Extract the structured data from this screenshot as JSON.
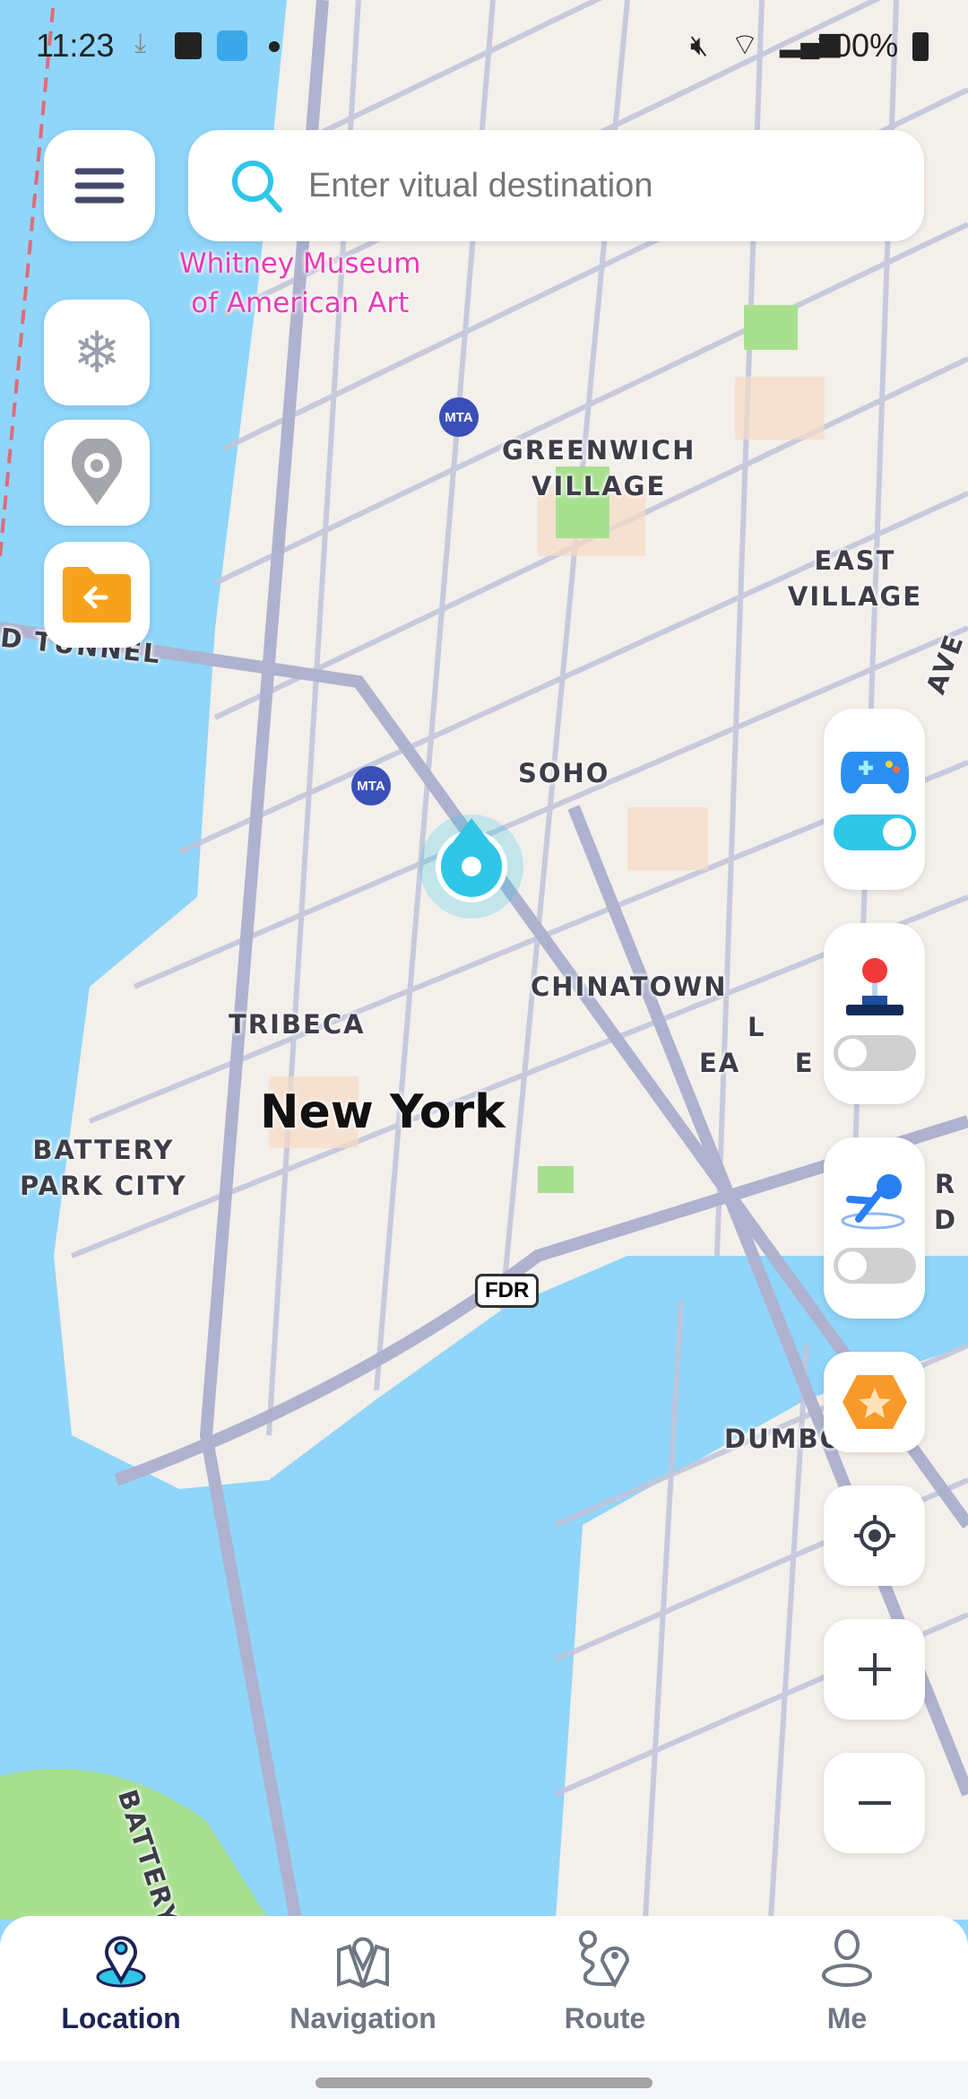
{
  "status_bar": {
    "time": "11:23",
    "battery": "100%"
  },
  "search": {
    "placeholder": "Enter vitual destination"
  },
  "map": {
    "labels": [
      {
        "text": "GREENWICH\nVILLAGE"
      },
      {
        "text": "EAST VILLAGE"
      },
      {
        "text": "SOHO"
      },
      {
        "text": "CHINATOWN"
      },
      {
        "text": "TRIBECA"
      },
      {
        "text": "L\nEA     E"
      },
      {
        "text": "BATTERY\nPARK CITY"
      },
      {
        "text": "DUMBO"
      },
      {
        "text": "D TUNNEL"
      },
      {
        "text": "AVE"
      },
      {
        "text": "R D"
      },
      {
        "text": "BATTERY TUNN"
      }
    ],
    "city": "New York",
    "poi": "Whitney Museum\nof American Art",
    "road_shield": "FDR",
    "metro_badge": "MTA",
    "colors": {
      "water": "#8fd6fa",
      "land": "#f3efea",
      "street": "#b9bdd6",
      "park": "#9fdc8a",
      "accent": "#2fc6e8"
    }
  },
  "left_tools": [
    "snowflake-icon",
    "pokeball-pin-icon",
    "folder-back-icon"
  ],
  "right_tools": {
    "game_mode": {
      "icon": "gamepad-icon",
      "enabled": true
    },
    "joystick": {
      "icon": "joystick-icon",
      "enabled": false
    },
    "auto_walk": {
      "icon": "runner-icon",
      "enabled": false
    }
  },
  "nav": {
    "items": [
      {
        "label": "Location",
        "active": true
      },
      {
        "label": "Navigation",
        "active": false
      },
      {
        "label": "Route",
        "active": false
      },
      {
        "label": "Me",
        "active": false
      }
    ]
  }
}
